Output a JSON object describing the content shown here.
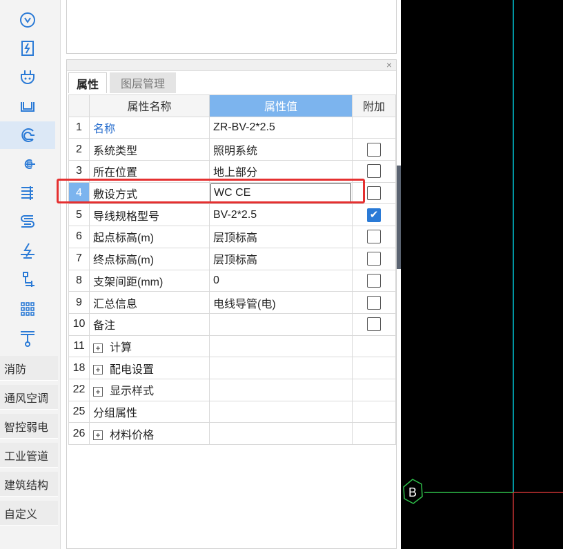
{
  "toolbar": {
    "tools": [
      "socket-icon",
      "distribution-box-icon",
      "plug-icon",
      "tray-icon",
      "wire-icon",
      "conduit-icon",
      "busbar-icon",
      "coil-icon",
      "grounding-icon",
      "pipe-icon",
      "grid-icon",
      "tee-icon"
    ],
    "selected_tool": "wire-icon",
    "categories": [
      "消防",
      "通风空调",
      "智控弱电",
      "工业管道",
      "建筑结构",
      "自定义"
    ]
  },
  "panel": {
    "close_label": "×",
    "tabs": [
      "属性",
      "图层管理"
    ],
    "active_tab": "属性",
    "columns": [
      "属性名称",
      "属性值",
      "附加"
    ],
    "rows": [
      {
        "num": "1",
        "name": "名称",
        "value": "ZR-BV-2*2.5",
        "checkbox": "none"
      },
      {
        "num": "2",
        "name": "系统类型",
        "value": "照明系统",
        "checkbox": "off"
      },
      {
        "num": "3",
        "name": "所在位置",
        "value": "地上部分",
        "checkbox": "off"
      },
      {
        "num": "4",
        "name": "敷设方式",
        "value": "WC CE",
        "checkbox": "off"
      },
      {
        "num": "5",
        "name": "导线规格型号",
        "value": "BV-2*2.5",
        "checkbox": "on"
      },
      {
        "num": "6",
        "name": "起点标高(m)",
        "value": "层顶标高",
        "checkbox": "off"
      },
      {
        "num": "7",
        "name": "终点标高(m)",
        "value": "层顶标高",
        "checkbox": "off"
      },
      {
        "num": "8",
        "name": "支架间距(mm)",
        "value": "0",
        "checkbox": "off"
      },
      {
        "num": "9",
        "name": "汇总信息",
        "value": "电线导管(电)",
        "checkbox": "off"
      },
      {
        "num": "10",
        "name": "备注",
        "value": "",
        "checkbox": "off"
      },
      {
        "num": "11",
        "name": "计算",
        "value": "",
        "checkbox": "none",
        "expand": "+"
      },
      {
        "num": "18",
        "name": "配电设置",
        "value": "",
        "checkbox": "none",
        "expand": "+"
      },
      {
        "num": "22",
        "name": "显示样式",
        "value": "",
        "checkbox": "none",
        "expand": "+"
      },
      {
        "num": "25",
        "name": "分组属性",
        "value": "",
        "checkbox": "none"
      },
      {
        "num": "26",
        "name": "材料价格",
        "value": "",
        "checkbox": "none",
        "expand": "+"
      }
    ],
    "highlight_row": "4"
  },
  "canvas": {
    "axis_label": "B",
    "colors": {
      "background": "#000000",
      "vertical_line": "#00c8d8",
      "horizontal_line": "#2fbf4a",
      "red_line": "#c83232",
      "bubble": "#2fbf4a"
    }
  }
}
